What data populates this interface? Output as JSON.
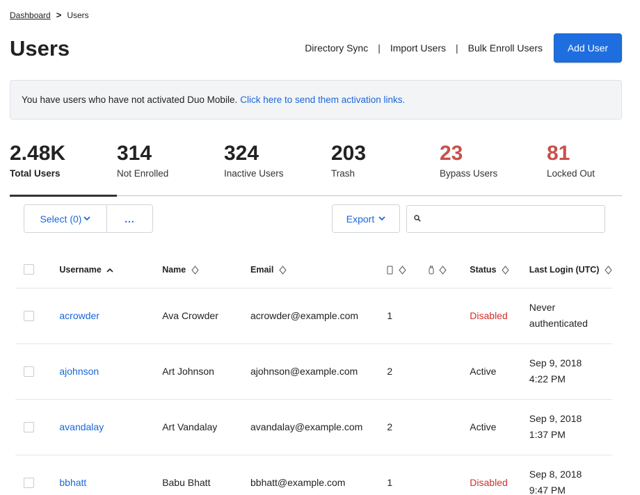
{
  "breadcrumb": {
    "home": "Dashboard",
    "separator": ">",
    "current": "Users"
  },
  "page": {
    "title": "Users"
  },
  "top_actions": {
    "directory_sync": "Directory Sync",
    "divider": "|",
    "import_users": "Import Users",
    "bulk_enroll": "Bulk Enroll Users",
    "add_user": "Add User"
  },
  "notice": {
    "text": "You have users who have not activated Duo Mobile.",
    "link": "Click here to send them activation links."
  },
  "stats": [
    {
      "value": "2.48K",
      "label": "Total Users",
      "active": true
    },
    {
      "value": "314",
      "label": "Not Enrolled"
    },
    {
      "value": "324",
      "label": "Inactive Users"
    },
    {
      "value": "203",
      "label": "Trash"
    },
    {
      "value": "23",
      "label": "Bypass Users"
    },
    {
      "value": "81",
      "label": "Locked Out"
    }
  ],
  "toolbar": {
    "select_label": "Select (0)",
    "more_label": "...",
    "export_label": "Export",
    "search_placeholder": ""
  },
  "table": {
    "columns": {
      "username": "Username",
      "name": "Name",
      "email": "Email",
      "status": "Status",
      "last_login": "Last Login (UTC)"
    },
    "rows": [
      {
        "username": "acrowder",
        "name": "Ava Crowder",
        "email": "acrowder@example.com",
        "phones": "1",
        "tokens": "",
        "status": "Disabled",
        "login_line1": "Never",
        "login_line2": "authenticated"
      },
      {
        "username": "ajohnson",
        "name": "Art Johnson",
        "email": "ajohnson@example.com",
        "phones": "2",
        "tokens": "",
        "status": "Active",
        "login_line1": "Sep 9, 2018",
        "login_line2": "4:22 PM"
      },
      {
        "username": "avandalay",
        "name": "Art Vandalay",
        "email": "avandalay@example.com",
        "phones": "2",
        "tokens": "",
        "status": "Active",
        "login_line1": "Sep 9, 2018",
        "login_line2": "1:37 PM"
      },
      {
        "username": "bbhatt",
        "name": "Babu Bhatt",
        "email": "bbhatt@example.com",
        "phones": "1",
        "tokens": "",
        "status": "Disabled",
        "login_line1": "Sep 8, 2018",
        "login_line2": "9:47 PM"
      }
    ]
  },
  "colors": {
    "accent": "#1e6ee0",
    "link": "#1a66d9",
    "danger": "#d12f2a",
    "stat_red": "#c9504b"
  },
  "icons": {
    "sort_asc": "chevron-up-icon",
    "sort_both": "sort-diamond-icon",
    "phone": "phone-icon",
    "token": "token-icon",
    "search": "search-icon",
    "dropdown": "chevron-down-icon"
  }
}
